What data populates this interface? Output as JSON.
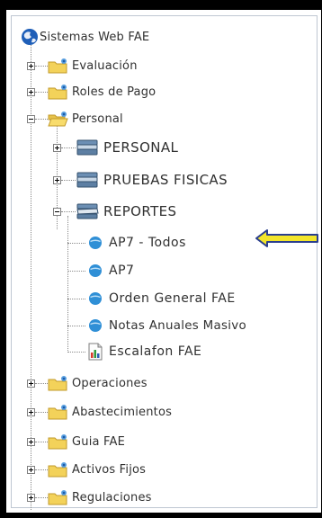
{
  "tree": {
    "root_label": "Sistemas Web FAE",
    "nodes": {
      "evaluacion": "Evaluación",
      "roles_pago": "Roles de Pago",
      "personal": "Personal",
      "personal_upper": "PERSONAL",
      "pruebas_fisicas": "PRUEBAS FISICAS",
      "reportes": "REPORTES",
      "ap7_todos": "AP7 - Todos",
      "ap7": "AP7",
      "orden_general": "Orden General FAE",
      "notas_anuales": "Notas Anuales Masivo",
      "escalafon": "Escalafon FAE",
      "operaciones": "Operaciones",
      "abastecimientos": "Abastecimientos",
      "guia_fae": "Guia FAE",
      "activos_fijos": "Activos Fijos",
      "regulaciones": "Regulaciones"
    }
  },
  "colors": {
    "frame": "#000000",
    "panel_border": "#bfc7d2",
    "folder": "#f3d25a",
    "leaf_dot": "#2f8fd6",
    "arrow_fill": "#f2e52b",
    "arrow_outline": "#2a3e8e"
  },
  "icons": {
    "root": "globe-icon",
    "category": "folder-user-icon",
    "section": "book-stack-icon",
    "report": "blue-dot-icon",
    "document": "chart-document-icon",
    "annotation": "left-arrow-icon"
  }
}
